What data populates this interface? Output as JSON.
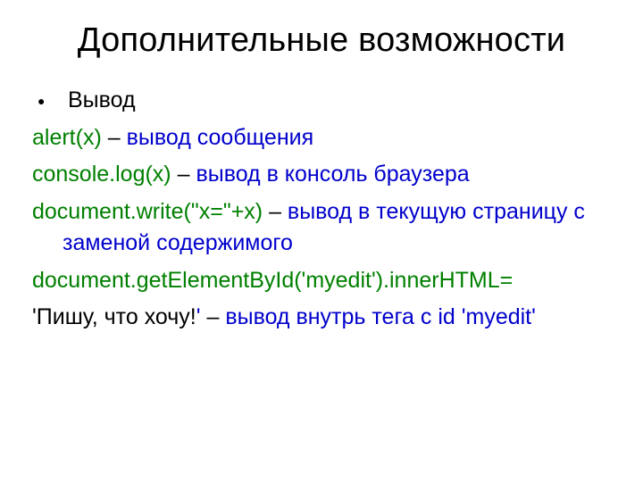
{
  "title": "Дополнительные возможности",
  "bullet": {
    "dot": "●",
    "text": "Вывод"
  },
  "lines": {
    "l1_code": "alert(x)",
    "l1_dash": " – ",
    "l1_blue": "вывод сообщения",
    "l2_code": "console.log(x)",
    "l2_dash": " – ",
    "l2_blue": "вывод в консоль браузера",
    "l3_code": "document.write(\"x=\"+x)",
    "l3_dash": " – ",
    "l3_blue": "вывод в текущую страницу с заменой содержимого",
    "l4_code": "document.getElementById('myedit').innerHTML=",
    "l5_black": "'Пишу, что хочу!",
    "l5_blue1": "'",
    "l5_dash": " – ",
    "l5_blue2": "вывод внутрь тега с id 'myedit'"
  }
}
